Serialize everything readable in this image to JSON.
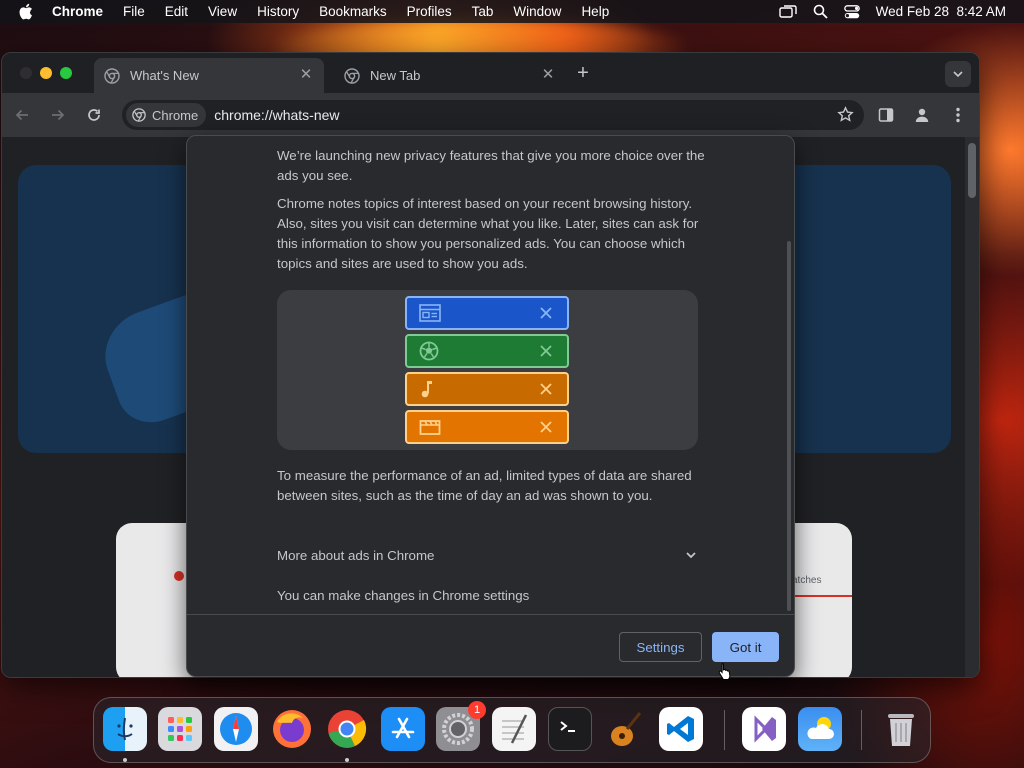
{
  "menubar": {
    "app_name": "Chrome",
    "items": [
      "File",
      "Edit",
      "View",
      "History",
      "Bookmarks",
      "Profiles",
      "Tab",
      "Window",
      "Help"
    ],
    "datetime": "Wed Feb 28  8:42 AM"
  },
  "tabs": [
    {
      "title": "What's New",
      "active": true
    },
    {
      "title": "New Tab",
      "active": false
    }
  ],
  "toolbar": {
    "chip_label": "Chrome",
    "url": "chrome://whats-new"
  },
  "dialog": {
    "para1": "We’re launching new privacy features that give you more choice over the ads you see.",
    "para2": "Chrome notes topics of interest based on your recent browsing history. Also, sites you visit can determine what you like. Later, sites can ask for this information to show you personalized ads. You can choose which topics and sites are used to show you ads.",
    "para3": "To measure the performance of an ad, limited types of data are shared between sites, such as the time of day an ad was shown to you.",
    "accordion_label": "More about ads in Chrome",
    "settings_note": "You can make changes in Chrome settings",
    "settings_button": "Settings",
    "got_it_button": "Got it",
    "topics": [
      {
        "icon": "news-icon",
        "color": "#1a56c9"
      },
      {
        "icon": "sports-icon",
        "color": "#1e7b33"
      },
      {
        "icon": "music-icon",
        "color": "#c76a00"
      },
      {
        "icon": "movie-icon",
        "color": "#e37400"
      }
    ]
  },
  "background": {
    "side_label": "atches"
  },
  "dock": {
    "apps": [
      "Finder",
      "Launchpad",
      "Safari",
      "Firefox",
      "Chrome",
      "App Store",
      "System Settings",
      "TextEdit",
      "Terminal",
      "GarageBand",
      "Visual Studio Code",
      "Visual Studio",
      "Weather",
      "Trash"
    ],
    "settings_badge": "1"
  }
}
